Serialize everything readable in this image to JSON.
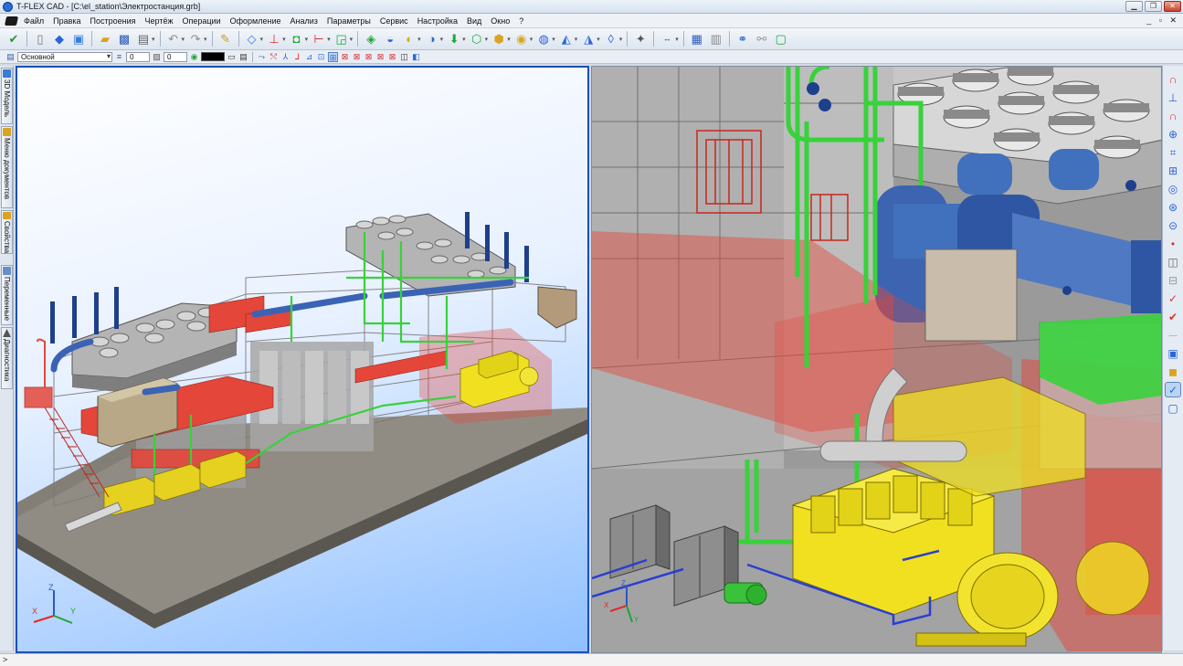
{
  "window": {
    "title": "T-FLEX CAD - [C:\\el_station\\Электростанция.grb]",
    "controls": [
      "▁",
      "❐",
      "✕"
    ]
  },
  "menu": {
    "items": [
      "Файл",
      "Правка",
      "Построения",
      "Чертёж",
      "Операции",
      "Оформление",
      "Анализ",
      "Параметры",
      "Сервис",
      "Настройка",
      "Вид",
      "Окно",
      "?"
    ],
    "mdi_controls": "_ ▫ ✕"
  },
  "toolbar2": {
    "layer": "Основной",
    "field1_value": "0",
    "field2_value": "0"
  },
  "left_panel": {
    "tabs": [
      "3D Модель",
      "Меню документов",
      "Свойства",
      "Переменные",
      "Диагностика"
    ]
  },
  "viewport_left": {
    "axis_labels": {
      "x": "X",
      "y": "Y",
      "z": "Z"
    }
  },
  "viewport_right": {
    "axis_labels": {
      "x": "X",
      "y": "Y",
      "z": "Z"
    }
  },
  "statusbar": {
    "prompt": ">"
  },
  "colors": {
    "accent": "#1d4fb5",
    "pipe_green": "#3ed63e",
    "pipe_blue": "#2b56a8",
    "engine_yellow": "#f0e020",
    "hood_red": "#e4463a",
    "floor_gray": "#8f8a80"
  },
  "icons": {
    "toolbar1": [
      "check-double-icon",
      "new-doc-icon",
      "3d-cube-icon",
      "open-window-icon",
      "open-folder-icon",
      "save-icon",
      "print-icon",
      "undo-icon",
      "redo-icon",
      "pencil-icon",
      "select-icon",
      "point-icon",
      "workplane-icon",
      "axis-icon",
      "lcs-icon",
      "extrude-icon",
      "rotate-icon",
      "loft-icon",
      "shell-icon",
      "boolean-icon",
      "array-icon",
      "pipe-icon",
      "fillet-icon",
      "chamfer-icon",
      "cut-icon",
      "surface-icon",
      "measure-icon",
      "dimension-icon",
      "spec-icon",
      "doc-icon",
      "link-icon",
      "variables-icon",
      "report-icon"
    ],
    "rightbar": [
      "magnet-icon",
      "snap-icon",
      "snap2-icon",
      "zoom-icon",
      "zoom-fit-icon",
      "zoom-box-icon",
      "zoom-prev-icon",
      "zoom-in-icon",
      "zoom-out-icon",
      "orbit-icon",
      "pan-icon",
      "section-icon",
      "check-icon",
      "check-multi-icon",
      "plane-icon",
      "cube-view-icon",
      "shaded-icon",
      "select-filter-icon",
      "frame-icon"
    ]
  }
}
